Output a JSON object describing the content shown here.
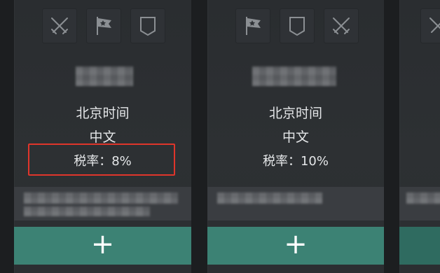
{
  "cards": [
    {
      "timezone_label": "北京时间",
      "language_label": "中文",
      "tax_label": "税率：8%",
      "icons": [
        "crossed-swords-icon",
        "star-flag-icon",
        "shield-icon"
      ],
      "add_label": "+"
    },
    {
      "timezone_label": "北京时间",
      "language_label": "中文",
      "tax_label": "税率：10%",
      "icons": [
        "star-flag-icon",
        "shield-icon",
        "crossed-swords-icon"
      ],
      "add_label": "+"
    },
    {
      "icons": [
        "crossed-swords-icon"
      ]
    }
  ],
  "colors": {
    "highlight": "#e0352b",
    "add_button": "#3c8274",
    "text": "#e4e6e8"
  }
}
